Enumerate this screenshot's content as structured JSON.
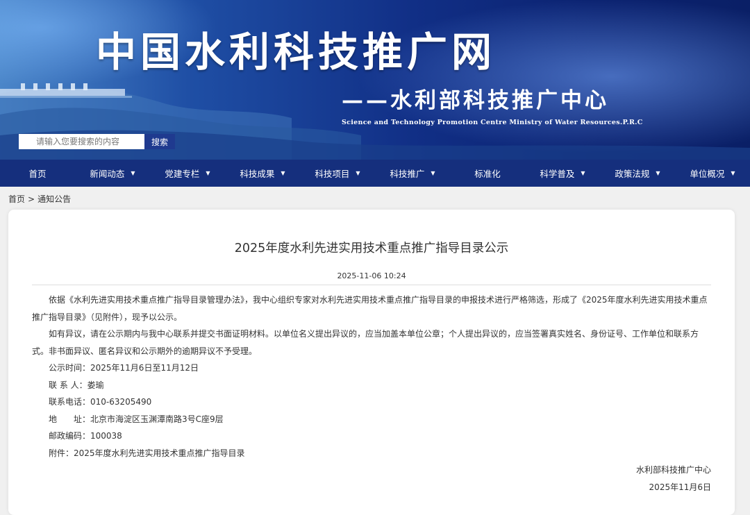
{
  "header": {
    "site_title": "中国水利科技推广网",
    "site_subtitle": "——水利部科技推广中心",
    "site_english": "Science and Technology Promotion Centre Ministry of Water Resources.P.R.C",
    "search": {
      "placeholder": "请输入您要搜索的内容",
      "button_label": "搜索"
    }
  },
  "nav": {
    "items": [
      {
        "label": "首页",
        "has_dropdown": false
      },
      {
        "label": "新闻动态",
        "has_dropdown": true
      },
      {
        "label": "党建专栏",
        "has_dropdown": true
      },
      {
        "label": "科技成果",
        "has_dropdown": true
      },
      {
        "label": "科技项目",
        "has_dropdown": true
      },
      {
        "label": "科技推广",
        "has_dropdown": true
      },
      {
        "label": "标准化",
        "has_dropdown": false
      },
      {
        "label": "科学普及",
        "has_dropdown": true
      },
      {
        "label": "政策法规",
        "has_dropdown": true
      },
      {
        "label": "单位概况",
        "has_dropdown": true
      }
    ],
    "caret": "▼"
  },
  "breadcrumb": {
    "home": "首页",
    "separator": ">",
    "current": "通知公告"
  },
  "article": {
    "title": "2025年度水利先进实用技术重点推广指导目录公示",
    "date": "2025-11-06 10:24",
    "paragraphs": [
      "依据《水利先进实用技术重点推广指导目录管理办法》，我中心组织专家对水利先进实用技术重点推广指导目录的申报技术进行严格筛选，形成了《2025年度水利先进实用技术重点推广指导目录》（见附件），现予以公示。",
      "如有异议，请在公示期内与我中心联系并提交书面证明材料。以单位名义提出异议的，应当加盖本单位公章；个人提出异议的，应当签署真实姓名、身份证号、工作单位和联系方式。非书面异议、匿名异议和公示期外的逾期异议不予受理。"
    ],
    "info_lines": [
      "公示时间：2025年11月6日至11月12日",
      "联 系 人：娄瑜",
      "联系电话：010-63205490",
      "地　　址：北京市海淀区玉渊潭南路3号C座9层",
      "邮政编码：100038",
      "附件：2025年度水利先进实用技术重点推广指导目录"
    ],
    "signature_org": "水利部科技推广中心",
    "signature_date": "2025年11月6日"
  },
  "colors": {
    "nav_bg": "#152f7d",
    "search_button": "#1f3a8f",
    "banner_dark": "#0a1f66"
  }
}
